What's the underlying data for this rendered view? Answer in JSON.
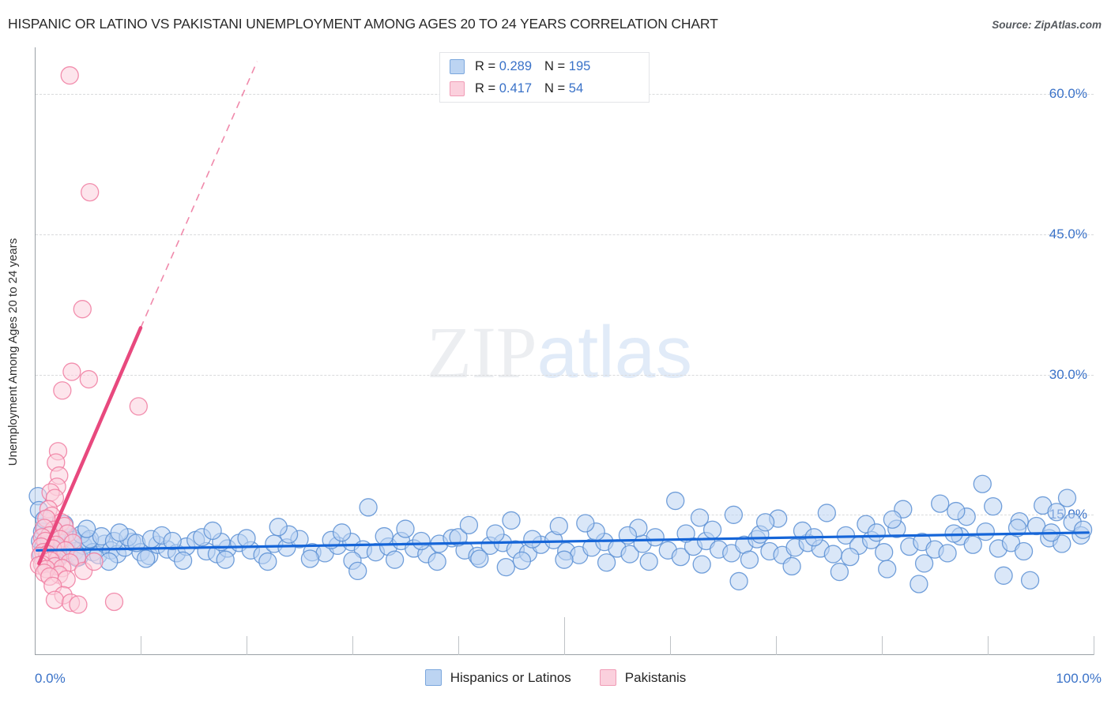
{
  "header": {
    "title": "HISPANIC OR LATINO VS PAKISTANI UNEMPLOYMENT AMONG AGES 20 TO 24 YEARS CORRELATION CHART",
    "source": "Source: ZipAtlas.com"
  },
  "watermark": {
    "part1": "ZIP",
    "part2": "atlas"
  },
  "stats_legend": {
    "rows": [
      {
        "series": "Hispanics or Latinos",
        "color": "#bcd4f2",
        "r_label": "R =",
        "r_value": "0.289",
        "n_label": "N =",
        "n_value": "195"
      },
      {
        "series": "Pakistanis",
        "color": "#fbd0dd",
        "r_label": "R =",
        "r_value": "0.417",
        "n_label": "N =",
        "n_value": "54"
      }
    ]
  },
  "bottom_legend": {
    "items": [
      {
        "label": "Hispanics or Latinos",
        "color": "#bcd4f2"
      },
      {
        "label": "Pakistanis",
        "color": "#fbd0dd"
      }
    ]
  },
  "chart_data": {
    "type": "scatter",
    "title": "HISPANIC OR LATINO VS PAKISTANI UNEMPLOYMENT AMONG AGES 20 TO 24 YEARS CORRELATION CHART",
    "xlabel": "",
    "ylabel": "Unemployment Among Ages 20 to 24 years",
    "xlim": [
      0,
      100
    ],
    "ylim": [
      0,
      65
    ],
    "x_tick_labels": [
      "0.0%",
      "100.0%"
    ],
    "x_ticks": [
      0,
      10,
      20,
      30,
      40,
      50,
      60,
      70,
      80,
      90,
      100
    ],
    "y_tick_labels": [
      "60.0%",
      "45.0%",
      "30.0%",
      "15.0%"
    ],
    "y_ticks": [
      60,
      45,
      30,
      15
    ],
    "grid": true,
    "legend_position": "bottom",
    "accent_blue": "#3a72c8",
    "accent_pink": "#e8497e",
    "series": [
      {
        "name": "Hispanics or Latinos",
        "color": "#bcd4f2",
        "stroke": "#5b8fd4",
        "r": 0.289,
        "n": 195,
        "trendline": {
          "x0": 0.2,
          "y0": 11.2,
          "x1": 99.5,
          "y1": 13.1,
          "style": "solid",
          "color": "#1565d8"
        },
        "points": [
          [
            0.3,
            17.0
          ],
          [
            0.4,
            15.5
          ],
          [
            0.5,
            12.2
          ],
          [
            0.6,
            10.8
          ],
          [
            0.8,
            11.5
          ],
          [
            1.0,
            13.6
          ],
          [
            1.1,
            11.0
          ],
          [
            1.3,
            12.4
          ],
          [
            1.5,
            10.4
          ],
          [
            1.7,
            11.8
          ],
          [
            1.9,
            13.0
          ],
          [
            2.1,
            11.3
          ],
          [
            2.3,
            10.6
          ],
          [
            2.6,
            12.0
          ],
          [
            2.9,
            11.4
          ],
          [
            3.2,
            10.9
          ],
          [
            3.5,
            12.6
          ],
          [
            3.8,
            11.1
          ],
          [
            4.2,
            10.5
          ],
          [
            4.6,
            11.7
          ],
          [
            5.0,
            12.2
          ],
          [
            5.5,
            11.0
          ],
          [
            6.0,
            10.7
          ],
          [
            6.6,
            11.9
          ],
          [
            7.2,
            11.2
          ],
          [
            7.8,
            10.8
          ],
          [
            8.5,
            11.5
          ],
          [
            9.2,
            12.1
          ],
          [
            10.0,
            11.0
          ],
          [
            10.8,
            10.6
          ],
          [
            11.6,
            11.8
          ],
          [
            12.5,
            11.3
          ],
          [
            13.4,
            10.9
          ],
          [
            14.3,
            11.6
          ],
          [
            15.2,
            12.3
          ],
          [
            16.2,
            11.1
          ],
          [
            17.2,
            10.8
          ],
          [
            18.2,
            11.4
          ],
          [
            19.3,
            12.0
          ],
          [
            20.4,
            11.2
          ],
          [
            21.5,
            10.7
          ],
          [
            22.6,
            11.9
          ],
          [
            23.8,
            11.5
          ],
          [
            25.0,
            12.4
          ],
          [
            26.2,
            11.0
          ],
          [
            27.4,
            10.9
          ],
          [
            28.6,
            11.7
          ],
          [
            29.9,
            12.1
          ],
          [
            31.0,
            11.3
          ],
          [
            31.5,
            15.8
          ],
          [
            32.2,
            11.0
          ],
          [
            33.4,
            11.6
          ],
          [
            34.6,
            12.2
          ],
          [
            35.8,
            11.4
          ],
          [
            37.0,
            10.8
          ],
          [
            38.2,
            11.9
          ],
          [
            39.4,
            12.5
          ],
          [
            40.6,
            11.2
          ],
          [
            41.8,
            10.6
          ],
          [
            43.0,
            11.7
          ],
          [
            44.2,
            12.0
          ],
          [
            45.4,
            11.3
          ],
          [
            46.6,
            10.9
          ],
          [
            47.8,
            11.8
          ],
          [
            49.0,
            12.3
          ],
          [
            50.2,
            11.1
          ],
          [
            51.4,
            10.7
          ],
          [
            52.6,
            11.5
          ],
          [
            53.8,
            12.1
          ],
          [
            55.0,
            11.4
          ],
          [
            56.2,
            10.8
          ],
          [
            57.4,
            11.9
          ],
          [
            58.6,
            12.6
          ],
          [
            59.8,
            11.2
          ],
          [
            61.0,
            10.5
          ],
          [
            62.2,
            11.6
          ],
          [
            63.4,
            12.2
          ],
          [
            64.6,
            11.3
          ],
          [
            65.8,
            10.9
          ],
          [
            67.0,
            11.8
          ],
          [
            68.2,
            12.4
          ],
          [
            69.4,
            11.1
          ],
          [
            70.6,
            10.7
          ],
          [
            71.8,
            11.5
          ],
          [
            73.0,
            12.0
          ],
          [
            74.2,
            11.4
          ],
          [
            75.4,
            10.8
          ],
          [
            76.6,
            12.8
          ],
          [
            77.8,
            11.7
          ],
          [
            79.0,
            12.3
          ],
          [
            80.2,
            11.0
          ],
          [
            81.4,
            13.5
          ],
          [
            82.6,
            11.6
          ],
          [
            83.8,
            12.1
          ],
          [
            85.0,
            11.3
          ],
          [
            86.2,
            10.9
          ],
          [
            87.4,
            12.7
          ],
          [
            88.6,
            11.8
          ],
          [
            89.8,
            13.2
          ],
          [
            91.0,
            11.4
          ],
          [
            92.2,
            12.0
          ],
          [
            93.4,
            11.1
          ],
          [
            94.6,
            13.8
          ],
          [
            95.8,
            12.5
          ],
          [
            97.0,
            11.9
          ],
          [
            98.0,
            14.2
          ],
          [
            98.8,
            12.8
          ],
          [
            60.5,
            16.5
          ],
          [
            66.0,
            15.0
          ],
          [
            70.2,
            14.6
          ],
          [
            74.8,
            15.2
          ],
          [
            78.5,
            14.0
          ],
          [
            82.0,
            15.6
          ],
          [
            85.5,
            16.2
          ],
          [
            88.0,
            14.8
          ],
          [
            90.5,
            15.9
          ],
          [
            93.0,
            14.3
          ],
          [
            95.2,
            16.0
          ],
          [
            96.5,
            15.3
          ],
          [
            89.5,
            18.3
          ],
          [
            97.5,
            16.8
          ],
          [
            86.8,
            13.0
          ],
          [
            84.0,
            9.8
          ],
          [
            80.5,
            9.2
          ],
          [
            76.0,
            8.9
          ],
          [
            71.5,
            9.5
          ],
          [
            67.5,
            10.2
          ],
          [
            63.0,
            9.7
          ],
          [
            58.0,
            10.0
          ],
          [
            54.0,
            9.9
          ],
          [
            50.0,
            10.2
          ],
          [
            46.0,
            10.1
          ],
          [
            42.0,
            10.3
          ],
          [
            38.0,
            10.0
          ],
          [
            34.0,
            10.2
          ],
          [
            30.0,
            10.1
          ],
          [
            26.0,
            10.3
          ],
          [
            22.0,
            10.0
          ],
          [
            18.0,
            10.2
          ],
          [
            14.0,
            10.1
          ],
          [
            10.5,
            10.3
          ],
          [
            7.0,
            10.0
          ],
          [
            4.0,
            10.4
          ],
          [
            2.0,
            10.1
          ],
          [
            1.2,
            9.8
          ],
          [
            91.5,
            8.5
          ],
          [
            83.5,
            7.6
          ],
          [
            94.0,
            8.0
          ],
          [
            66.5,
            7.9
          ],
          [
            77.0,
            10.5
          ],
          [
            30.5,
            9.0
          ],
          [
            44.5,
            9.4
          ],
          [
            49.5,
            13.8
          ],
          [
            53.0,
            13.2
          ],
          [
            57.0,
            13.6
          ],
          [
            61.5,
            13.0
          ],
          [
            64.0,
            13.4
          ],
          [
            68.5,
            12.9
          ],
          [
            72.5,
            13.3
          ],
          [
            79.5,
            13.1
          ],
          [
            0.7,
            13.2
          ],
          [
            0.9,
            14.5
          ],
          [
            1.4,
            12.8
          ],
          [
            1.8,
            13.4
          ],
          [
            2.5,
            12.5
          ],
          [
            3.0,
            13.0
          ],
          [
            3.6,
            12.3
          ],
          [
            4.4,
            12.9
          ],
          [
            5.2,
            12.4
          ],
          [
            6.3,
            12.7
          ],
          [
            7.5,
            12.2
          ],
          [
            8.8,
            12.6
          ],
          [
            9.6,
            12.0
          ],
          [
            11.0,
            12.4
          ],
          [
            12.0,
            12.8
          ],
          [
            13.0,
            12.2
          ],
          [
            15.8,
            12.6
          ],
          [
            17.6,
            12.1
          ],
          [
            20.0,
            12.5
          ],
          [
            24.0,
            12.9
          ],
          [
            28.0,
            12.3
          ],
          [
            33.0,
            12.7
          ],
          [
            36.5,
            12.2
          ],
          [
            40.0,
            12.6
          ],
          [
            43.5,
            13.0
          ],
          [
            47.0,
            12.4
          ],
          [
            2.8,
            14.0
          ],
          [
            4.9,
            13.5
          ],
          [
            8.0,
            13.1
          ],
          [
            16.8,
            13.3
          ],
          [
            23.0,
            13.7
          ],
          [
            29.0,
            13.1
          ],
          [
            35.0,
            13.5
          ],
          [
            41.0,
            13.9
          ],
          [
            45.0,
            14.4
          ],
          [
            52.0,
            14.1
          ],
          [
            56.0,
            12.8
          ],
          [
            62.8,
            14.7
          ],
          [
            69.0,
            14.2
          ],
          [
            73.6,
            12.6
          ],
          [
            81.0,
            14.5
          ],
          [
            87.0,
            15.4
          ],
          [
            92.8,
            13.6
          ],
          [
            96.0,
            13.1
          ],
          [
            99.0,
            13.4
          ]
        ]
      },
      {
        "name": "Pakistanis",
        "color": "#fbd0dd",
        "stroke": "#f07ba0",
        "r": 0.417,
        "n": 54,
        "trendline": {
          "x0": 0.4,
          "y0": 9.8,
          "x1": 10.0,
          "y1": 35.0,
          "style": "solid",
          "dashed_extension": {
            "x0": 10.0,
            "y0": 35.0,
            "x1": 21.0,
            "y1": 63.5
          },
          "color": "#e8497e"
        },
        "points": [
          [
            3.3,
            62.0
          ],
          [
            5.2,
            49.5
          ],
          [
            4.5,
            37.0
          ],
          [
            3.5,
            30.3
          ],
          [
            5.1,
            29.5
          ],
          [
            2.6,
            28.3
          ],
          [
            9.8,
            26.6
          ],
          [
            2.2,
            21.8
          ],
          [
            2.0,
            20.6
          ],
          [
            2.3,
            19.2
          ],
          [
            2.1,
            18.0
          ],
          [
            1.5,
            17.4
          ],
          [
            1.9,
            16.8
          ],
          [
            1.3,
            15.6
          ],
          [
            1.6,
            14.9
          ],
          [
            2.5,
            14.2
          ],
          [
            1.1,
            14.6
          ],
          [
            2.8,
            13.8
          ],
          [
            1.8,
            13.4
          ],
          [
            3.1,
            13.0
          ],
          [
            0.9,
            13.6
          ],
          [
            1.4,
            12.8
          ],
          [
            2.4,
            12.4
          ],
          [
            0.7,
            12.6
          ],
          [
            3.6,
            12.0
          ],
          [
            1.0,
            12.2
          ],
          [
            2.0,
            11.8
          ],
          [
            0.6,
            11.6
          ],
          [
            1.7,
            11.4
          ],
          [
            2.9,
            11.2
          ],
          [
            0.8,
            11.0
          ],
          [
            1.2,
            10.8
          ],
          [
            4.0,
            10.5
          ],
          [
            0.5,
            10.6
          ],
          [
            2.2,
            10.3
          ],
          [
            1.5,
            10.1
          ],
          [
            3.3,
            9.9
          ],
          [
            0.7,
            9.7
          ],
          [
            1.9,
            9.5
          ],
          [
            2.6,
            9.3
          ],
          [
            0.4,
            9.6
          ],
          [
            1.1,
            9.2
          ],
          [
            4.6,
            9.0
          ],
          [
            0.9,
            8.8
          ],
          [
            2.3,
            8.6
          ],
          [
            1.4,
            8.4
          ],
          [
            3.0,
            8.1
          ],
          [
            5.6,
            10.0
          ],
          [
            1.7,
            7.4
          ],
          [
            2.7,
            6.4
          ],
          [
            1.9,
            5.9
          ],
          [
            3.4,
            5.6
          ],
          [
            4.1,
            5.4
          ],
          [
            7.5,
            5.7
          ]
        ]
      }
    ]
  },
  "axes": {
    "y_labels": [
      "60.0%",
      "45.0%",
      "30.0%",
      "15.0%"
    ],
    "x_min_label": "0.0%",
    "x_max_label": "100.0%",
    "y_title": "Unemployment Among Ages 20 to 24 years"
  }
}
